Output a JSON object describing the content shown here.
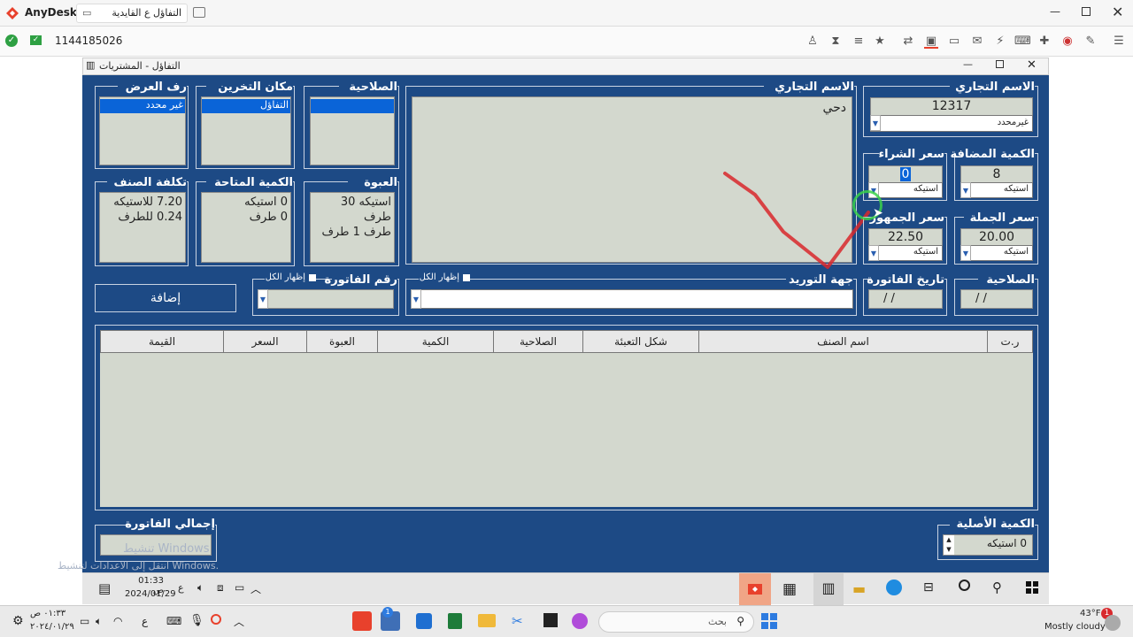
{
  "anydesk": {
    "app_name": "AnyDesk",
    "tab_title": "التفاؤل ع القايدية",
    "address": "1144185026"
  },
  "window": {
    "title": "التفاؤل - المشتريات"
  },
  "form": {
    "trade_name_label": "الاسم التجاري",
    "code_value": "12317",
    "unspecified": "غيرمحدد",
    "trade_name_big_label": "الاسم التجاري",
    "trade_name_text": "دحي",
    "expiry_label": "الصلاحية",
    "storage_label": "مكان التخرين",
    "storage_option": "التفاؤل",
    "shelf_label": "رف العرض",
    "shelf_option": "غير محدد",
    "pack_label": "العبوة",
    "pack_line1": "استيكه 30 طرف",
    "pack_line2": "طرف 1 طرف",
    "available_label": "الكمية المتاحة",
    "available_line1": "0 استيكه",
    "available_line2": "0 طرف",
    "cost_label": "تكلفة الصنف",
    "cost_line1": "7.20 للاستيكه",
    "cost_line2": "0.24 للطرف",
    "added_qty_label": "الكمية المضافة",
    "added_qty_value": "8",
    "purchase_price_label": "سعر الشراء",
    "purchase_price_value": "0",
    "wholesale_label": "سعر الجملة",
    "wholesale_value": "20.00",
    "public_price_label": "سعر الجمهور",
    "public_price_value": "22.50",
    "unit_option": "استيكه",
    "expiry2_label": "الصلاحية",
    "expiry2_value": "/ /",
    "invoice_date_label": "تاريخ الفاتورة",
    "invoice_date_value": "/ /",
    "supplier_label": "جهة التوريد",
    "show_all": "إظهار الكل",
    "invoice_no_label": "رقم الفاتورة",
    "add_button": "إضافة"
  },
  "table": {
    "columns": [
      "ر.ت",
      "اسم الصنف",
      "شكل التعبئة",
      "الصلاحية",
      "الكمية",
      "العبوة",
      "السعر",
      "القيمة"
    ]
  },
  "bottom": {
    "original_qty_label": "الكمية الأصلية",
    "original_qty_value": "0 استيكه",
    "invoice_total_label": "إجمالي الفاتورة",
    "watermark1": "تنشيط Windows",
    "watermark2": "انتقل إلى الاعدادات لتنشيط Windows."
  },
  "remote_taskbar": {
    "time": "01:33 ص",
    "date": "2024/01/29",
    "lang": "ع"
  },
  "local_taskbar": {
    "search_placeholder": "بحث",
    "time": "٠١:٣٣ ص",
    "date": "٢٠٢٤/٠١/٢٩",
    "lang": "ع",
    "weather_temp": "43°F",
    "weather_desc": "Mostly cloudy",
    "badge": "1"
  },
  "colors": {
    "app_bg": "#1d4a85",
    "field_bg": "#d3d8ce",
    "anydesk_red": "#e8412c",
    "selection_blue": "#0a64d8"
  }
}
